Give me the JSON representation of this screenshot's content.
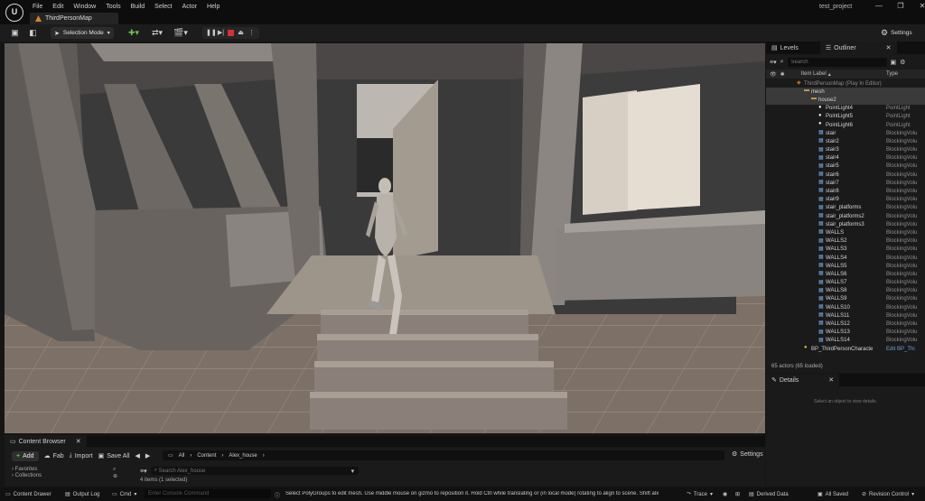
{
  "titlebar": {
    "menu": [
      "File",
      "Edit",
      "Window",
      "Tools",
      "Build",
      "Select",
      "Actor",
      "Help"
    ],
    "level_tab": "ThirdPersonMap",
    "project": "test_project"
  },
  "toolbar": {
    "selection_mode": "Selection Mode",
    "settings": "Settings"
  },
  "outliner": {
    "tabs": [
      "Levels",
      "Outliner"
    ],
    "search_placeholder": "Search",
    "col_label": "Item Label",
    "col_type": "Type",
    "rows": [
      {
        "label": "ThirdPersonMap (Play In Editor)",
        "type": "",
        "indent": 0,
        "icon": "map"
      },
      {
        "label": "mesh",
        "type": "",
        "indent": 1,
        "icon": "folder"
      },
      {
        "label": "house2",
        "type": "",
        "indent": 2,
        "icon": "folder"
      },
      {
        "label": "PointLight4",
        "type": "PointLight",
        "indent": 3,
        "icon": "light"
      },
      {
        "label": "PointLight5",
        "type": "PointLight",
        "indent": 3,
        "icon": "light"
      },
      {
        "label": "PointLight6",
        "type": "PointLight",
        "indent": 3,
        "icon": "light"
      },
      {
        "label": "stair",
        "type": "BlockingVolu",
        "indent": 3,
        "icon": "volume"
      },
      {
        "label": "stair2",
        "type": "BlockingVolu",
        "indent": 3,
        "icon": "volume"
      },
      {
        "label": "stair3",
        "type": "BlockingVolu",
        "indent": 3,
        "icon": "volume"
      },
      {
        "label": "stair4",
        "type": "BlockingVolu",
        "indent": 3,
        "icon": "volume"
      },
      {
        "label": "stair5",
        "type": "BlockingVolu",
        "indent": 3,
        "icon": "volume"
      },
      {
        "label": "stair6",
        "type": "BlockingVolu",
        "indent": 3,
        "icon": "volume"
      },
      {
        "label": "stair7",
        "type": "BlockingVolu",
        "indent": 3,
        "icon": "volume"
      },
      {
        "label": "stair8",
        "type": "BlockingVolu",
        "indent": 3,
        "icon": "volume"
      },
      {
        "label": "stair9",
        "type": "BlockingVolu",
        "indent": 3,
        "icon": "volume"
      },
      {
        "label": "stair_platforms",
        "type": "BlockingVolu",
        "indent": 3,
        "icon": "volume"
      },
      {
        "label": "stair_platforms2",
        "type": "BlockingVolu",
        "indent": 3,
        "icon": "volume"
      },
      {
        "label": "stair_platforms3",
        "type": "BlockingVolu",
        "indent": 3,
        "icon": "volume"
      },
      {
        "label": "WALLS",
        "type": "BlockingVolu",
        "indent": 3,
        "icon": "volume"
      },
      {
        "label": "WALLS2",
        "type": "BlockingVolu",
        "indent": 3,
        "icon": "volume"
      },
      {
        "label": "WALLS3",
        "type": "BlockingVolu",
        "indent": 3,
        "icon": "volume"
      },
      {
        "label": "WALLS4",
        "type": "BlockingVolu",
        "indent": 3,
        "icon": "volume"
      },
      {
        "label": "WALLS5",
        "type": "BlockingVolu",
        "indent": 3,
        "icon": "volume"
      },
      {
        "label": "WALLS6",
        "type": "BlockingVolu",
        "indent": 3,
        "icon": "volume"
      },
      {
        "label": "WALLS7",
        "type": "BlockingVolu",
        "indent": 3,
        "icon": "volume"
      },
      {
        "label": "WALLS8",
        "type": "BlockingVolu",
        "indent": 3,
        "icon": "volume"
      },
      {
        "label": "WALLS9",
        "type": "BlockingVolu",
        "indent": 3,
        "icon": "volume"
      },
      {
        "label": "WALLS10",
        "type": "BlockingVolu",
        "indent": 3,
        "icon": "volume"
      },
      {
        "label": "WALLS11",
        "type": "BlockingVolu",
        "indent": 3,
        "icon": "volume"
      },
      {
        "label": "WALLS12",
        "type": "BlockingVolu",
        "indent": 3,
        "icon": "volume"
      },
      {
        "label": "WALLS13",
        "type": "BlockingVolu",
        "indent": 3,
        "icon": "volume"
      },
      {
        "label": "WALLS14",
        "type": "BlockingVolu",
        "indent": 3,
        "icon": "volume"
      },
      {
        "label": "BP_ThirdPersonCharacte",
        "type": "Edit BP_Thi",
        "indent": 1,
        "icon": "pawn"
      }
    ],
    "actor_count": "65 actors (65 loaded)"
  },
  "details": {
    "tab": "Details",
    "hint": "Select an object to view details."
  },
  "content_browser": {
    "tab": "Content Browser",
    "add": "Add",
    "fab": "Fab",
    "import": "Import",
    "save_all": "Save All",
    "path": [
      "All",
      "Content",
      "Alex_house"
    ],
    "settings": "Settings",
    "favorites": "Favorites",
    "collections": "Collections",
    "search_placeholder": "Search Alex_house",
    "items": "4 items (1 selected)"
  },
  "statusbar": {
    "content_drawer": "Content Drawer",
    "output_log": "Output Log",
    "cmd": "Cmd",
    "console_placeholder": "Enter Console Command",
    "message": "Select PolyGroups to edit mesh. Use middle mouse on gizmo to reposition it. Hold Ctrl while translating or (in local mode) rotating to align to scene. Shift alx",
    "trace": "Trace",
    "derived_data": "Derived Data",
    "all_saved": "All Saved",
    "revision_control": "Revision Control"
  }
}
